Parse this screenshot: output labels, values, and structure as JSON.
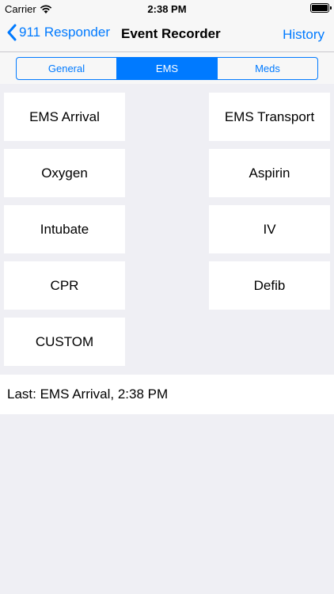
{
  "status_bar": {
    "carrier": "Carrier",
    "time": "2:38 PM"
  },
  "nav": {
    "back_label": "911 Responder",
    "title": "Event Recorder",
    "right_label": "History"
  },
  "tabs": [
    {
      "label": "General",
      "active": false
    },
    {
      "label": "EMS",
      "active": true
    },
    {
      "label": "Meds",
      "active": false
    }
  ],
  "buttons": {
    "ems_arrival": "EMS Arrival",
    "ems_transport": "EMS Transport",
    "oxygen": "Oxygen",
    "aspirin": "Aspirin",
    "intubate": "Intubate",
    "iv": "IV",
    "cpr": "CPR",
    "defib": "Defib",
    "custom": "CUSTOM"
  },
  "last_event": "Last: EMS Arrival, 2:38 PM",
  "colors": {
    "accent": "#007aff",
    "background": "#efeff4"
  }
}
